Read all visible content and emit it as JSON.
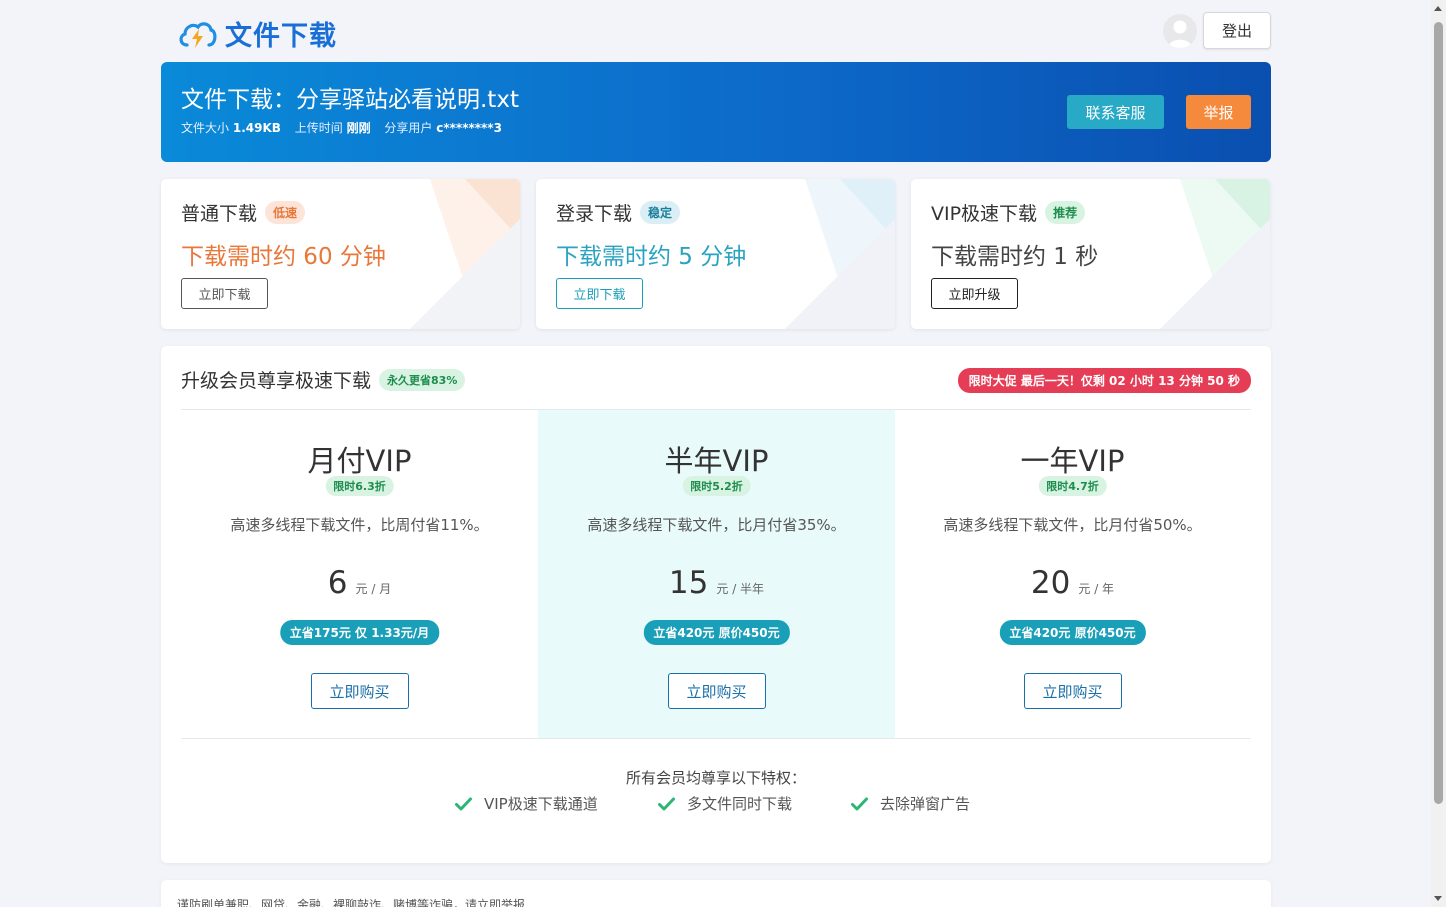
{
  "header": {
    "logo_text": "文件下载",
    "logout_label": "登出"
  },
  "banner": {
    "title": "文件下载：分享驿站必看说明.txt",
    "size_label": "文件大小",
    "size_value": "1.49KB",
    "upload_label": "上传时间",
    "upload_value": "刚刚",
    "user_label": "分享用户",
    "user_value": "c********3",
    "service_label": "联系客服",
    "report_label": "举报"
  },
  "download_cards": [
    {
      "name": "普通下载",
      "badge": "低速",
      "time": "下载需时约 60 分钟",
      "action": "立即下载"
    },
    {
      "name": "登录下载",
      "badge": "稳定",
      "time": "下载需时约 5 分钟",
      "action": "立即下载"
    },
    {
      "name": "VIP极速下载",
      "badge": "推荐",
      "time": "下载需时约 1 秒",
      "action": "立即升级"
    }
  ],
  "vip": {
    "title": "升级会员尊享极速下载",
    "title_badge": "永久更省83%",
    "promo": "限时大促 最后一天！仅剩 02 小时 13 分钟 50 秒",
    "plans": [
      {
        "name": "月付VIP",
        "discount": "限时6.3折",
        "desc": "高速多线程下载文件，比周付省11%。",
        "price": "6",
        "unit": "元 / 月",
        "save": "立省175元 仅 1.33元/月",
        "buy": "立即购买"
      },
      {
        "name": "半年VIP",
        "discount": "限时5.2折",
        "desc": "高速多线程下载文件，比月付省35%。",
        "price": "15",
        "unit": "元 / 半年",
        "save": "立省420元 原价450元",
        "buy": "立即购买"
      },
      {
        "name": "一年VIP",
        "discount": "限时4.7折",
        "desc": "高速多线程下载文件，比月付省50%。",
        "price": "20",
        "unit": "元 / 年",
        "save": "立省420元 原价450元",
        "buy": "立即购买"
      }
    ],
    "privileges_title": "所有会员均尊享以下特权：",
    "privileges": [
      "VIP极速下载通道",
      "多文件同时下载",
      "去除弹窗广告"
    ]
  },
  "footer": {
    "warning": "谨防刷单兼职、网贷、金融、裸聊敲诈、赌博等诈骗，请立即举报"
  },
  "colors": {
    "brand": "#1a6fd6",
    "orange": "#e8773a",
    "teal": "#1a9fb8",
    "red": "#e63d56",
    "green": "#1e8e4e"
  }
}
